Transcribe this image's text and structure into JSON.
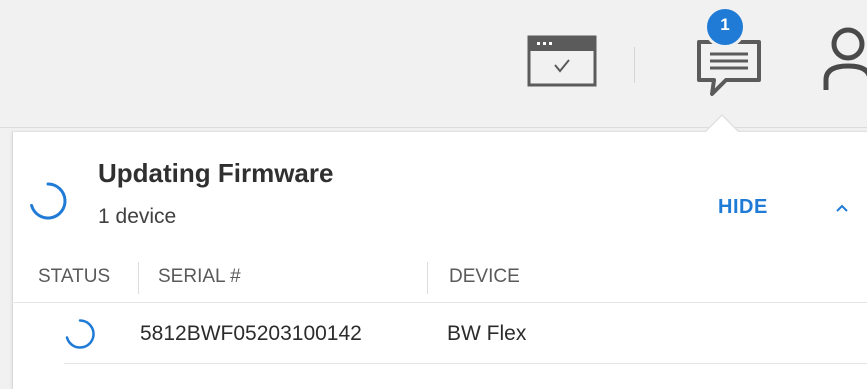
{
  "header": {
    "notification_count": "1",
    "icons": [
      "task-window-icon",
      "chat-notification-icon",
      "user-icon"
    ]
  },
  "firmware": {
    "title": "Updating Firmware",
    "subtitle": "1 device",
    "hide_label": "HIDE",
    "columns": [
      "STATUS",
      "SERIAL #",
      "DEVICE"
    ],
    "rows": [
      {
        "serial": "5812BWF05203100142",
        "device": "BW Flex"
      }
    ]
  },
  "colors": {
    "accent": "#1f7bd6",
    "header_bg": "#f1f1f1",
    "text": "#303030"
  }
}
